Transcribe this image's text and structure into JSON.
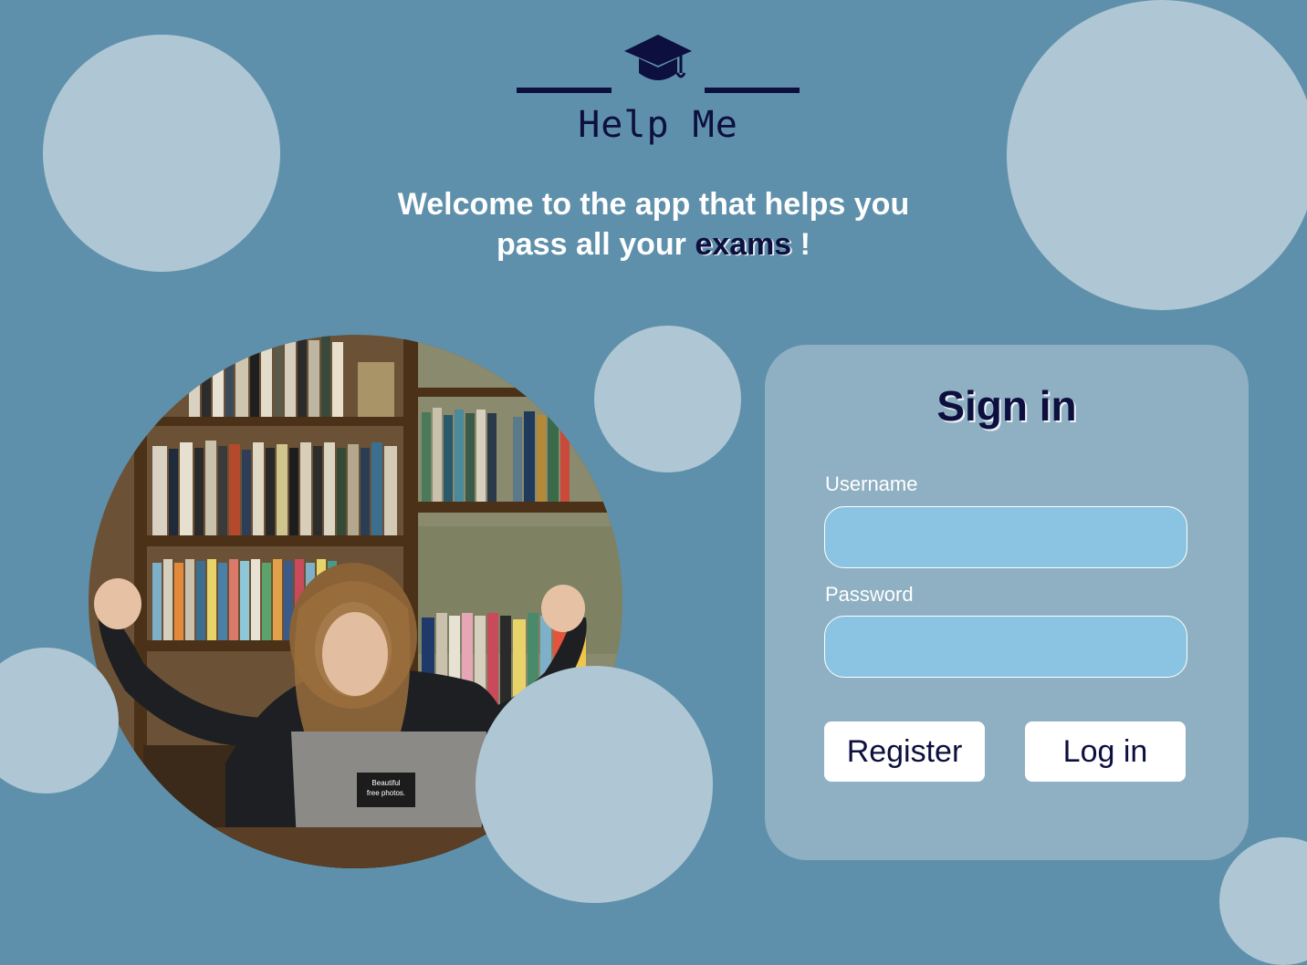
{
  "app": {
    "name": "Help Me",
    "logo_icon": "graduation-cap-icon"
  },
  "welcome": {
    "line1": "Welcome to the app that helps you",
    "line2_prefix": "pass all your ",
    "line2_highlight": "exams",
    "line2_suffix": " !"
  },
  "hero_image": {
    "sticker_text_1": "Beautiful",
    "sticker_text_2": "free photos."
  },
  "signin": {
    "title": "Sign in",
    "username_label": "Username",
    "username_value": "",
    "password_label": "Password",
    "password_value": "",
    "register_label": "Register",
    "login_label": "Log in"
  },
  "colors": {
    "background": "#5f90ab",
    "circle": "#afc7d4",
    "card": "#8fb0c2",
    "input": "#8ac4e2",
    "dark_text": "#0d0f3e"
  }
}
